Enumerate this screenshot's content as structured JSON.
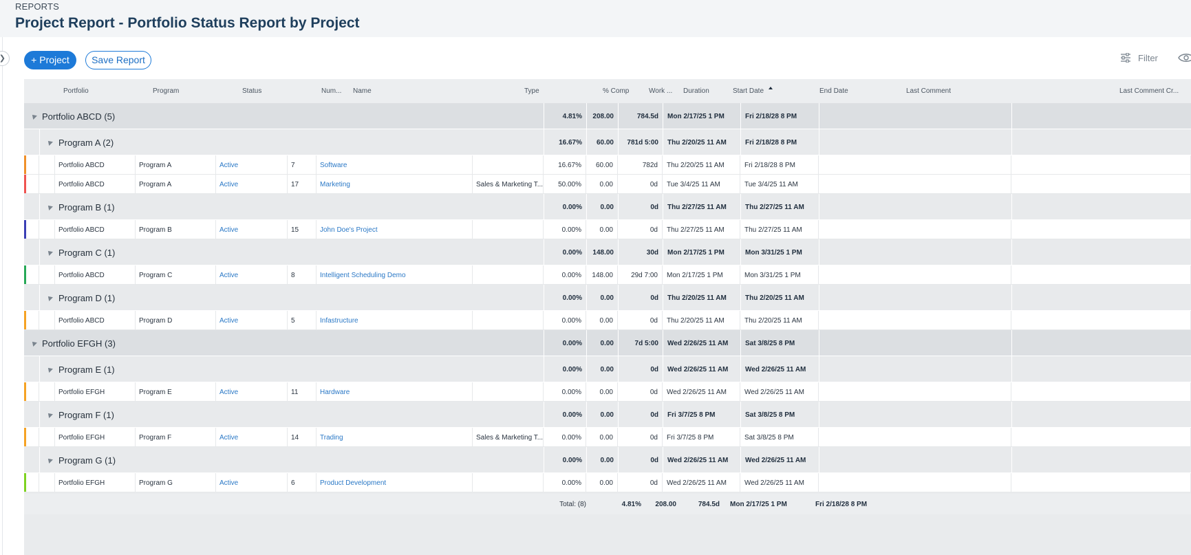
{
  "header": {
    "breadcrumb": "REPORTS",
    "title": "Project Report - Portfolio Status Report by Project"
  },
  "toolbar": {
    "add_project_label": "+ Project",
    "save_report_label": "Save Report",
    "filter_label": "Filter"
  },
  "columns": {
    "portfolio": "Portfolio",
    "program": "Program",
    "status": "Status",
    "num": "Num...",
    "name": "Name",
    "type": "Type",
    "pct": "% Comp",
    "work": "Work ...",
    "duration": "Duration",
    "start": "Start Date",
    "end": "End Date",
    "last_comment": "Last Comment",
    "last_comment_cr": "Last Comment Cr..."
  },
  "rows": [
    {
      "kind": "portfolio",
      "label": "Portfolio ABCD (5)",
      "pct": "4.81%",
      "work": "208.00",
      "duration": "784.5d",
      "start": "Mon 2/17/25 1 PM",
      "end": "Fri 2/18/28 8 PM"
    },
    {
      "kind": "program",
      "label": "Program A (2)",
      "pct": "16.67%",
      "work": "60.00",
      "duration": "781d 5:00",
      "start": "Thu 2/20/25 11 AM",
      "end": "Fri 2/18/28 8 PM"
    },
    {
      "kind": "project",
      "color": "#f0902a",
      "portfolio": "Portfolio ABCD",
      "program": "Program A",
      "status": "Active",
      "num": "7",
      "name": "Software",
      "type": "",
      "pct": "16.67%",
      "work": "60.00",
      "duration": "782d",
      "start": "Thu 2/20/25 11 AM",
      "end": "Fri 2/18/28 8 PM"
    },
    {
      "kind": "project",
      "color": "#ef5350",
      "portfolio": "Portfolio ABCD",
      "program": "Program A",
      "status": "Active",
      "num": "17",
      "name": "Marketing",
      "type": "Sales & Marketing T...",
      "pct": "50.00%",
      "work": "0.00",
      "duration": "0d",
      "start": "Tue 3/4/25 11 AM",
      "end": "Tue 3/4/25 11 AM"
    },
    {
      "kind": "program",
      "label": "Program B (1)",
      "pct": "0.00%",
      "work": "0.00",
      "duration": "0d",
      "start": "Thu 2/27/25 11 AM",
      "end": "Thu 2/27/25 11 AM"
    },
    {
      "kind": "project",
      "color": "#3b3fb5",
      "portfolio": "Portfolio ABCD",
      "program": "Program B",
      "status": "Active",
      "num": "15",
      "name": "John Doe's Project",
      "type": "",
      "pct": "0.00%",
      "work": "0.00",
      "duration": "0d",
      "start": "Thu 2/27/25 11 AM",
      "end": "Thu 2/27/25 11 AM"
    },
    {
      "kind": "program",
      "label": "Program C (1)",
      "pct": "0.00%",
      "work": "148.00",
      "duration": "30d",
      "start": "Mon 2/17/25 1 PM",
      "end": "Mon 3/31/25 1 PM"
    },
    {
      "kind": "project",
      "color": "#27a857",
      "portfolio": "Portfolio ABCD",
      "program": "Program C",
      "status": "Active",
      "num": "8",
      "name": "Intelligent Scheduling Demo",
      "type": "",
      "pct": "0.00%",
      "work": "148.00",
      "duration": "29d 7:00",
      "start": "Mon 2/17/25 1 PM",
      "end": "Mon 3/31/25 1 PM"
    },
    {
      "kind": "program",
      "label": "Program D (1)",
      "pct": "0.00%",
      "work": "0.00",
      "duration": "0d",
      "start": "Thu 2/20/25 11 AM",
      "end": "Thu 2/20/25 11 AM"
    },
    {
      "kind": "project",
      "color": "#f5a224",
      "portfolio": "Portfolio ABCD",
      "program": "Program D",
      "status": "Active",
      "num": "5",
      "name": "Infastructure",
      "type": "",
      "pct": "0.00%",
      "work": "0.00",
      "duration": "0d",
      "start": "Thu 2/20/25 11 AM",
      "end": "Thu 2/20/25 11 AM"
    },
    {
      "kind": "portfolio",
      "label": "Portfolio EFGH (3)",
      "pct": "0.00%",
      "work": "0.00",
      "duration": "7d 5:00",
      "start": "Wed 2/26/25 11 AM",
      "end": "Sat 3/8/25 8 PM"
    },
    {
      "kind": "program",
      "label": "Program E (1)",
      "pct": "0.00%",
      "work": "0.00",
      "duration": "0d",
      "start": "Wed 2/26/25 11 AM",
      "end": "Wed 2/26/25 11 AM"
    },
    {
      "kind": "project",
      "color": "#f5a224",
      "portfolio": "Portfolio EFGH",
      "program": "Program E",
      "status": "Active",
      "num": "11",
      "name": "Hardware",
      "type": "",
      "pct": "0.00%",
      "work": "0.00",
      "duration": "0d",
      "start": "Wed 2/26/25 11 AM",
      "end": "Wed 2/26/25 11 AM"
    },
    {
      "kind": "program",
      "label": "Program F (1)",
      "pct": "0.00%",
      "work": "0.00",
      "duration": "0d",
      "start": "Fri 3/7/25 8 PM",
      "end": "Sat 3/8/25 8 PM"
    },
    {
      "kind": "project",
      "color": "#f5a224",
      "portfolio": "Portfolio EFGH",
      "program": "Program F",
      "status": "Active",
      "num": "14",
      "name": "Trading",
      "type": "Sales & Marketing T...",
      "pct": "0.00%",
      "work": "0.00",
      "duration": "0d",
      "start": "Fri 3/7/25 8 PM",
      "end": "Sat 3/8/25 8 PM"
    },
    {
      "kind": "program",
      "label": "Program G (1)",
      "pct": "0.00%",
      "work": "0.00",
      "duration": "0d",
      "start": "Wed 2/26/25 11 AM",
      "end": "Wed 2/26/25 11 AM"
    },
    {
      "kind": "project",
      "color": "#7ed321",
      "portfolio": "Portfolio EFGH",
      "program": "Program G",
      "status": "Active",
      "num": "6",
      "name": "Product Development",
      "type": "",
      "pct": "0.00%",
      "work": "0.00",
      "duration": "0d",
      "start": "Wed 2/26/25 11 AM",
      "end": "Wed 2/26/25 11 AM"
    }
  ],
  "total": {
    "label": "Total: (8)",
    "pct": "4.81%",
    "work": "208.00",
    "duration": "784.5d",
    "start": "Mon 2/17/25 1 PM",
    "end": "Fri 2/18/28 8 PM"
  },
  "colors": {
    "accent": "#1d7ad8",
    "link": "#2a78c6"
  },
  "icons": {
    "collapse": "chevron-right-icon",
    "filter": "sliders-icon",
    "view": "eye-icon",
    "sort": "sort-ascending-icon",
    "group_toggle": "triangle-collapse-icon"
  }
}
